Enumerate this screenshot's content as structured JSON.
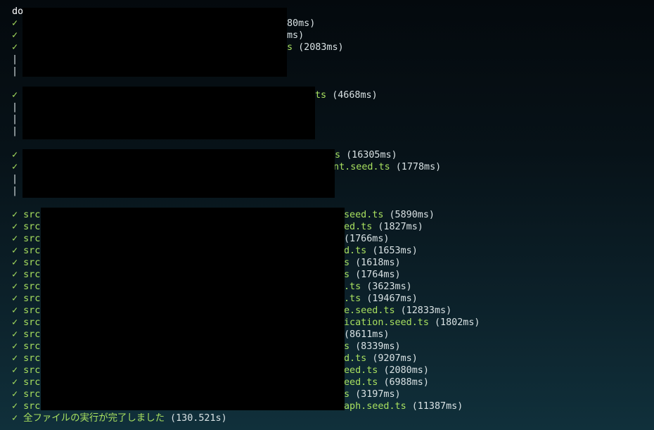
{
  "colors": {
    "accent": "#a8e05f",
    "text": "#d9e2e4",
    "redaction": "#000000"
  },
  "icons": {
    "check": "check-mark-icon",
    "pipe": "pipe-icon"
  },
  "glyphs": {
    "check": "✓",
    "pipe": "|"
  },
  "command_prefix": "do",
  "group1": {
    "line1_tail": "80ms)",
    "line2_tail": "ms)",
    "line3_path_tail": "s",
    "line3_duration": "(2083ms)"
  },
  "group2": {
    "line1_path_tail": "ts",
    "line1_duration": "(4668ms)"
  },
  "group3": {
    "line1_path_tail": "s",
    "line1_duration": "(16305ms)",
    "line2_path_tail": "int.seed.ts",
    "line2_duration": "(1778ms)"
  },
  "group4": {
    "prefix": "src",
    "rows": [
      {
        "path_tail": "seed.ts",
        "duration": "(5890ms)"
      },
      {
        "path_tail": "ed.ts",
        "duration": "(1827ms)"
      },
      {
        "path_tail": "",
        "duration": "(1766ms)"
      },
      {
        "path_tail": "d.ts",
        "duration": "(1653ms)"
      },
      {
        "path_tail": "s",
        "duration": "(1618ms)"
      },
      {
        "path_tail": "s",
        "duration": "(1764ms)"
      },
      {
        "path_tail": ".ts",
        "duration": "(3623ms)"
      },
      {
        "path_tail": ".ts",
        "duration": "(19467ms)"
      },
      {
        "path_tail": "e.seed.ts",
        "duration": "(12833ms)"
      },
      {
        "path_tail": "ication.seed.ts",
        "duration": "(1802ms)"
      },
      {
        "path_tail": "",
        "duration": "(8611ms)"
      },
      {
        "path_tail": "s",
        "duration": "(8339ms)"
      },
      {
        "path_tail": "d.ts",
        "duration": "(9207ms)"
      },
      {
        "path_tail": "eed.ts",
        "duration": "(2080ms)"
      },
      {
        "path_tail": "eed.ts",
        "duration": "(6988ms)"
      },
      {
        "path_tail": "s",
        "duration": "(3197ms)"
      },
      {
        "path_tail": "aph.seed.ts",
        "duration": "(11387ms)"
      }
    ]
  },
  "summary": {
    "message": "全ファイルの実行が完了しました",
    "duration": "(130.521s)"
  }
}
